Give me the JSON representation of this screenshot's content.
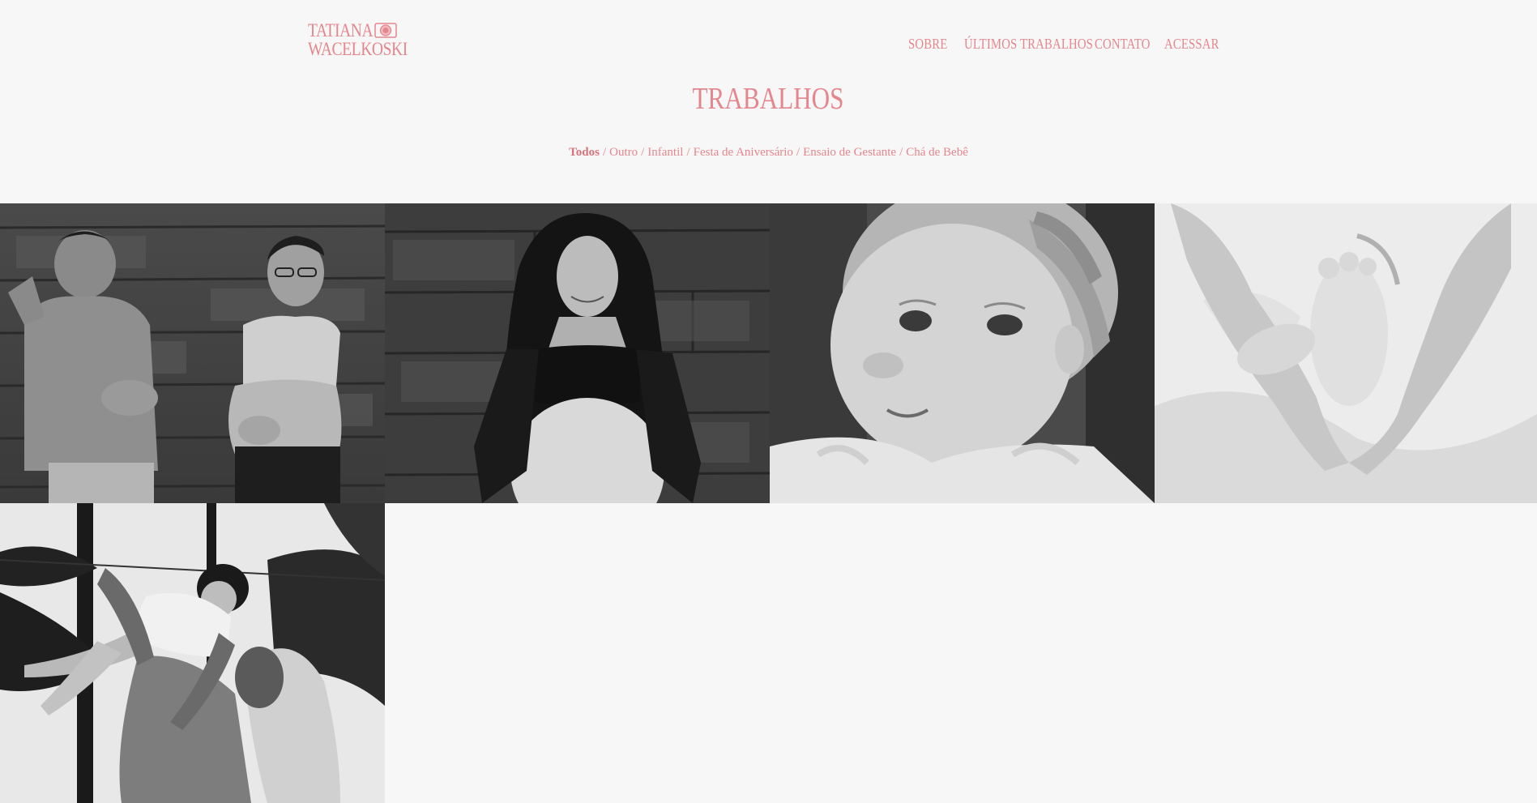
{
  "header": {
    "logo": {
      "line1": "TATIANA",
      "line2": "WACELKOSKI",
      "icon": "camera-icon"
    },
    "nav": [
      {
        "label": "SOBRE"
      },
      {
        "label": "ÚLTIMOS TRABALHOS"
      },
      {
        "label": "CONTATO"
      },
      {
        "label": "ACESSAR"
      }
    ]
  },
  "main": {
    "title": "TRABALHOS",
    "filters": [
      {
        "label": "Todos",
        "active": true
      },
      {
        "label": "Outro",
        "active": false
      },
      {
        "label": "Infantil",
        "active": false
      },
      {
        "label": "Festa de Aniversário",
        "active": false
      },
      {
        "label": "Ensaio de Gestante",
        "active": false
      },
      {
        "label": "Chá de Bebê",
        "active": false
      }
    ],
    "separator": "/",
    "gallery": [
      {
        "subject": "couple-pregnancy-photo"
      },
      {
        "subject": "pregnant-woman-photo"
      },
      {
        "subject": "toddler-portrait-photo"
      },
      {
        "subject": "baby-foot-hands-photo"
      },
      {
        "subject": "mother-lifting-baby-photo"
      }
    ]
  },
  "colors": {
    "accent": "#e5868d",
    "background": "#f7f7f7"
  }
}
